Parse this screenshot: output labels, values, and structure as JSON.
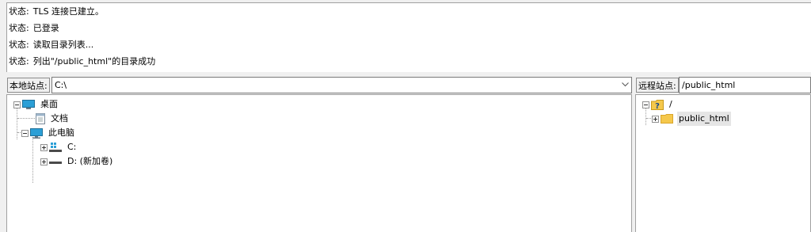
{
  "log": {
    "lines": [
      {
        "label": "状态:",
        "text": "TLS 连接已建立。"
      },
      {
        "label": "状态:",
        "text": "已登录"
      },
      {
        "label": "状态:",
        "text": "读取目录列表..."
      },
      {
        "label": "状态:",
        "text": "列出\"/public_html\"的目录成功"
      }
    ]
  },
  "local": {
    "site_label": "本地站点:",
    "path": "C:\\",
    "tree": {
      "desktop": "桌面",
      "documents": "文档",
      "this_pc": "此电脑",
      "drive_c": "C:",
      "drive_d": "D: (新加卷)"
    }
  },
  "remote": {
    "site_label": "远程站点:",
    "path": "/public_html",
    "tree": {
      "root": "/",
      "public_html": "public_html"
    }
  },
  "icons": {
    "desktop": "desktop-icon",
    "documents": "document-icon",
    "this_pc": "computer-icon",
    "drive_c": "system-drive-icon",
    "drive_d": "drive-icon",
    "remote_root": "unknown-folder-icon",
    "folder": "folder-icon"
  },
  "colors": {
    "folder": "#f5c84c",
    "monitor": "#2b9fd6",
    "selected": "#e5e5e5"
  }
}
